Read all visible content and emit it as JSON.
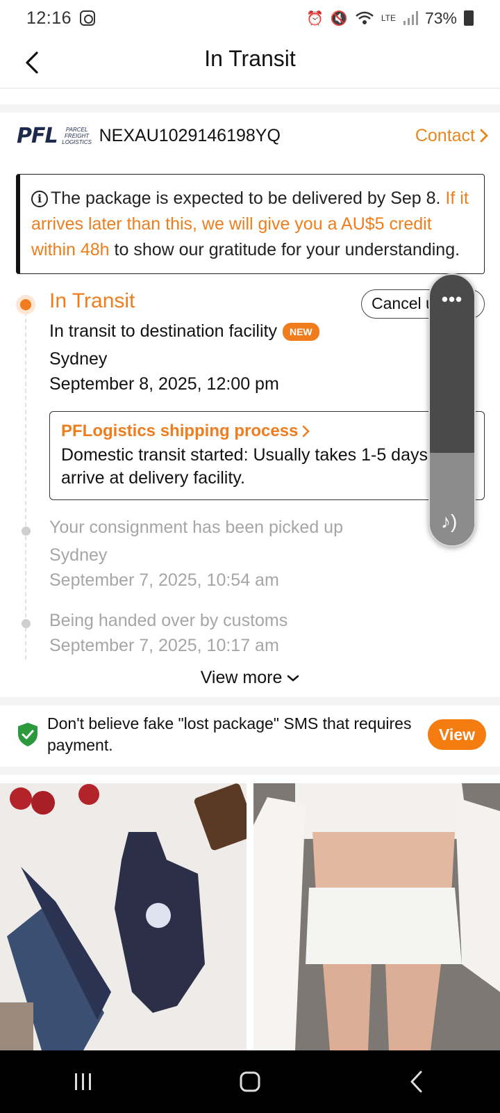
{
  "status_bar": {
    "time": "12:16",
    "battery": "73%",
    "network": "LTE"
  },
  "header": {
    "title": "In Transit"
  },
  "carrier": {
    "logo_mark": "PFL",
    "logo_sub": "PARCEL FREIGHT LOGISTICS",
    "tracking_number": "NEXAU1029146198YQ",
    "contact_label": "Contact"
  },
  "notice": {
    "text_plain": "The package is expected to be delivered by Sep 8. ",
    "text_highlight": "If it arrives later than this, we will give you a AU$5 credit within 48h",
    "text_tail": " to show our gratitude for your understanding."
  },
  "tracking": {
    "current": {
      "status": "In Transit",
      "cancel_label": "Cancel u",
      "event": "In transit to destination facility",
      "badge": "NEW",
      "location": "Sydney",
      "time": "September 8, 2025, 12:00 pm"
    },
    "process": {
      "title": "PFLogistics shipping process",
      "text_line1": "Domestic transit started: Usually takes 1-5 days",
      "text_line2": "arrive at delivery facility."
    },
    "history": [
      {
        "event": "Your consignment has been picked up",
        "location": "Sydney",
        "time": "September 7, 2025, 10:54 am"
      },
      {
        "event": "Being handed over by customs",
        "time": "September 7, 2025, 10:17 am"
      }
    ],
    "view_more_label": "View more"
  },
  "safety_banner": {
    "text": "Don't believe fake \"lost package\" SMS that requires payment.",
    "button_label": "View"
  },
  "icons": {
    "back": "chevron-left-icon",
    "info": "info-icon",
    "shield": "shield-check-icon",
    "music": "music-note-icon"
  },
  "colors": {
    "accent": "#ef7d1e",
    "shield_green": "#2a9a3c",
    "muted_text": "#a6a6a6"
  }
}
